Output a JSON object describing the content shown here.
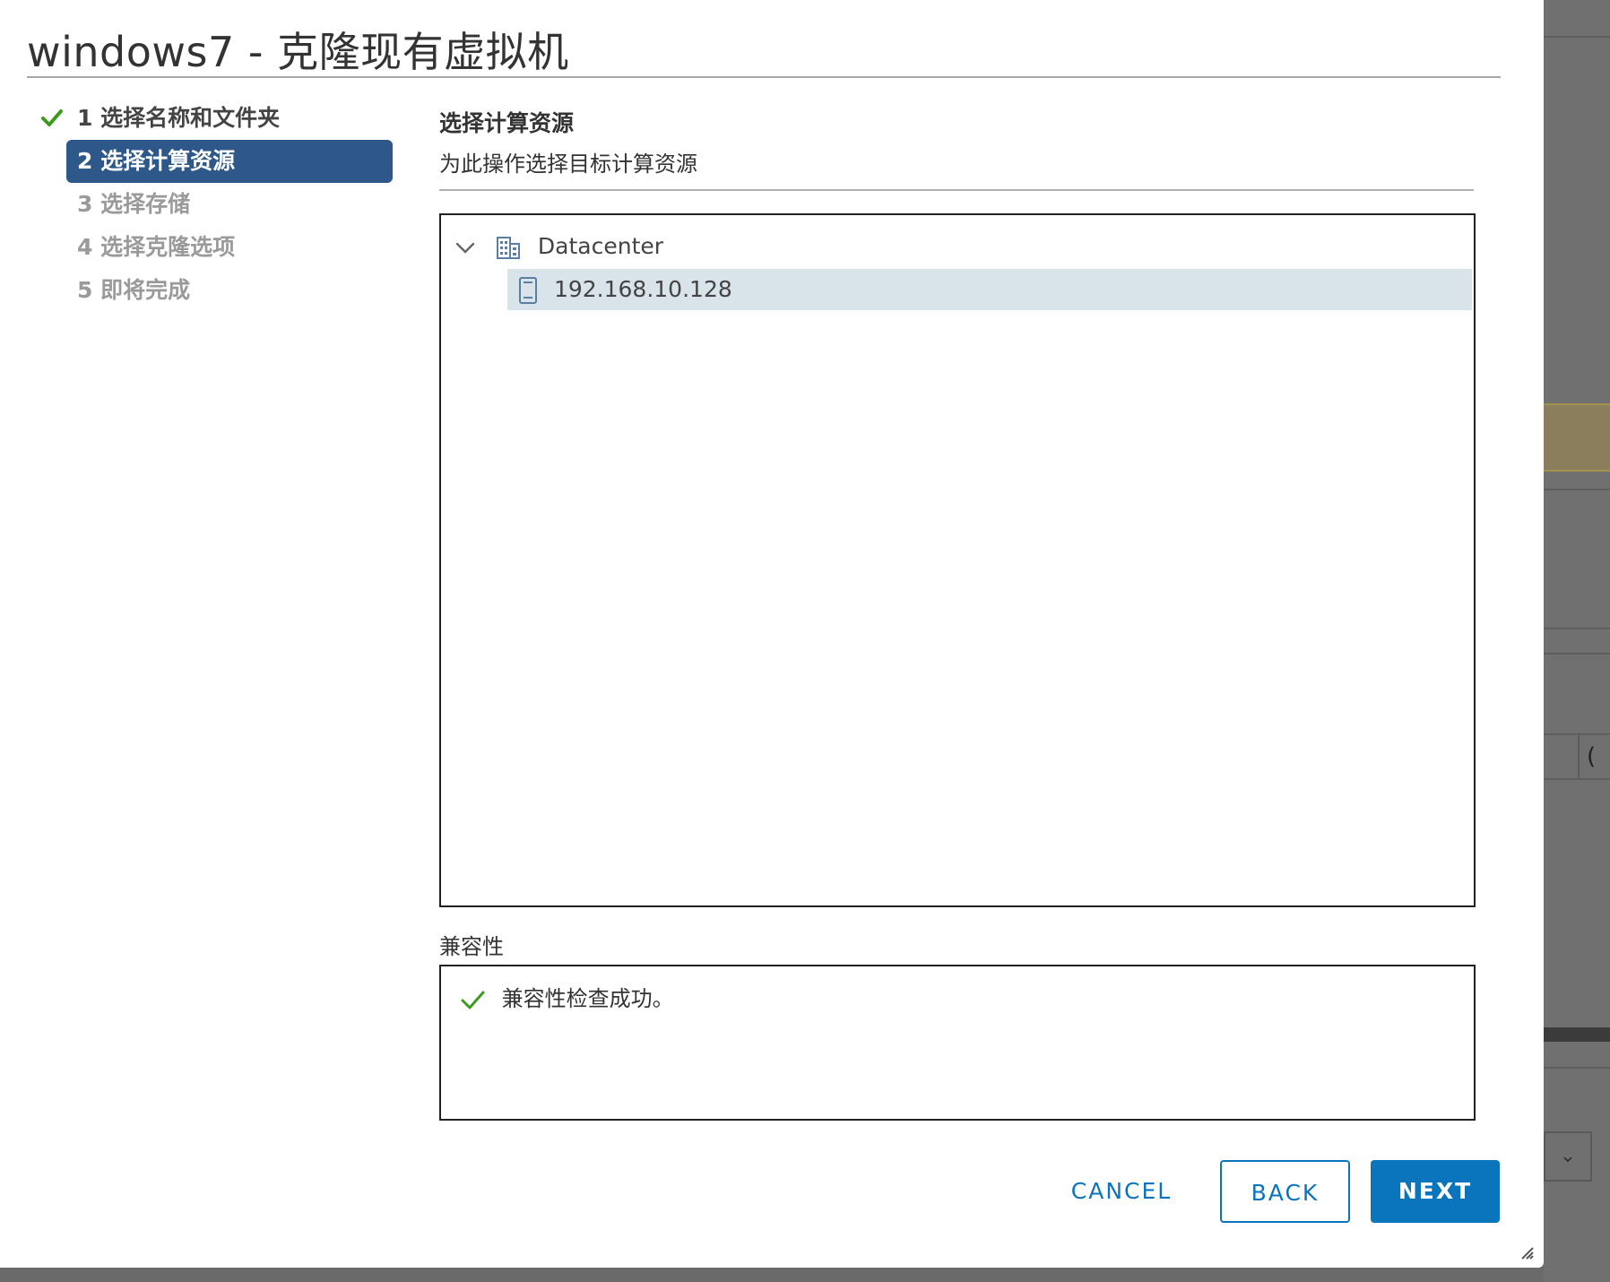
{
  "dialog": {
    "title": "windows7 - 克隆现有虚拟机"
  },
  "steps": [
    {
      "label": "1 选择名称和文件夹",
      "state": "done"
    },
    {
      "label": "2 选择计算资源",
      "state": "active"
    },
    {
      "label": "3 选择存储",
      "state": "pending"
    },
    {
      "label": "4 选择克隆选项",
      "state": "pending"
    },
    {
      "label": "5 即将完成",
      "state": "pending"
    }
  ],
  "main": {
    "title": "选择计算资源",
    "subtitle": "为此操作选择目标计算资源",
    "tree": {
      "datacenter": "Datacenter",
      "host": "192.168.10.128"
    },
    "compatibility": {
      "label": "兼容性",
      "message": "兼容性检查成功。"
    }
  },
  "buttons": {
    "cancel": "CANCEL",
    "back": "BACK",
    "next": "NEXT"
  },
  "icons": {
    "check": "check-icon",
    "chevron": "chevron-down-icon",
    "datacenter": "datacenter-icon",
    "host": "host-icon",
    "resize": "resize-grip-icon"
  },
  "colors": {
    "active_step_bg": "#2d5889",
    "primary": "#0a75bd",
    "success": "#3c9a1e",
    "selected_row": "#d8e3ea"
  }
}
